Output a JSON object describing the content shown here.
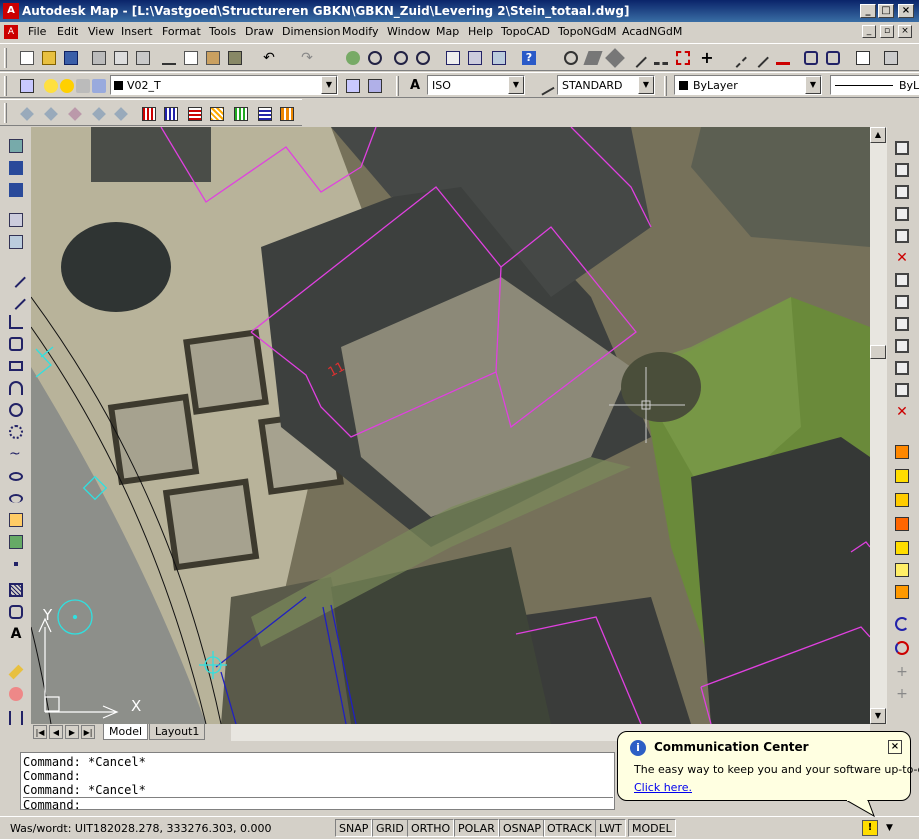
{
  "window": {
    "title": "Autodesk Map - [L:\\Vastgoed\\Structureren GBKN\\GBKN_Zuid\\Levering 2\\Stein_totaal.dwg]",
    "minimize": "_",
    "maximize": "□",
    "close": "×"
  },
  "menu": [
    "File",
    "Edit",
    "View",
    "Insert",
    "Format",
    "Tools",
    "Draw",
    "Dimension",
    "Modify",
    "Window",
    "Help",
    "Map",
    "Help",
    "TopoCAD",
    "TopoNGdM",
    "AcadNGdM"
  ],
  "layer_toolbar": {
    "layer_name": "V02_T",
    "text_style": "ISO",
    "dim_style": "STANDARD",
    "color": "ByLayer",
    "linetype": "ByL"
  },
  "drawing": {
    "ucs_y": "Y",
    "ucs_x": "X",
    "annotation": "11"
  },
  "layout_tabs": [
    {
      "label": "Model",
      "active": true
    },
    {
      "label": "Layout1",
      "active": false
    }
  ],
  "command_lines": [
    "Command: *Cancel*",
    "Command:",
    "Command: *Cancel*",
    "Command:"
  ],
  "status_bar": {
    "label": "Was/wordt: UIT",
    "coordinates": "182028.278, 333276.303, 0.000",
    "toggles": [
      "SNAP",
      "GRID",
      "ORTHO",
      "POLAR",
      "OSNAP",
      "OTRACK",
      "LWT",
      "MODEL"
    ]
  },
  "balloon": {
    "title": "Communication Center",
    "text": "The easy way to keep you and your software up-to-date.",
    "link": "Click here.",
    "close": "×",
    "info_icon": "i"
  },
  "colors": {
    "titlebar": "#0a246a",
    "polyline_magenta": "#e040e0",
    "polyline_cyan": "#30e0e0",
    "polyline_blue": "#2020c0"
  }
}
